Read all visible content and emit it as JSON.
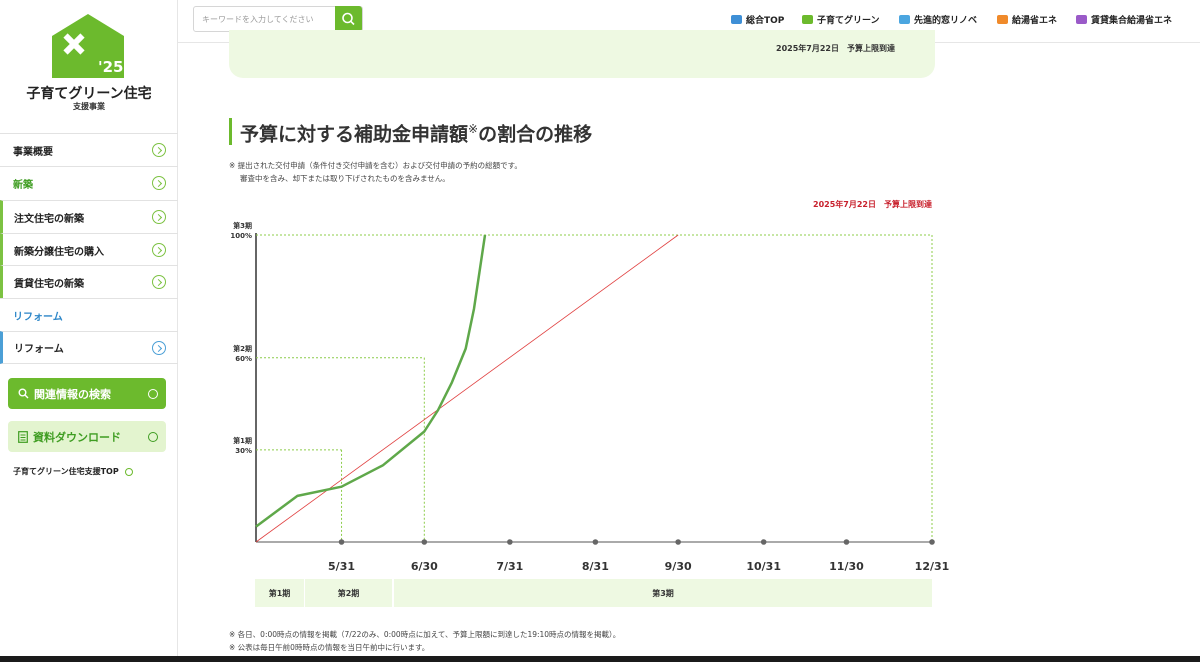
{
  "logo": {
    "year": "'25",
    "title": "子育てグリーン住宅",
    "subtitle": "支援事業"
  },
  "sidebar": {
    "items": [
      {
        "label": "事業概要"
      },
      {
        "label": "新築"
      },
      {
        "label": "注文住宅の新築"
      },
      {
        "label": "新築分譲住宅の購入"
      },
      {
        "label": "賃貸住宅の新築"
      },
      {
        "label": "リフォーム"
      },
      {
        "label": "リフォーム"
      }
    ],
    "search_button": "関連情報の検索",
    "download_button": "資料ダウンロード",
    "top_link": "子育てグリーン住宅支援TOP"
  },
  "topbar": {
    "search_placeholder": "キーワードを入力してください",
    "nav": [
      {
        "label": "総合TOP"
      },
      {
        "label": "子育てグリーン"
      },
      {
        "label": "先進的窓リノベ"
      },
      {
        "label": "給湯省エネ"
      },
      {
        "label": "賃貸集合給湯省エネ"
      }
    ]
  },
  "banner": {
    "date": "2025年7月22日",
    "status": "予算上限到達"
  },
  "section": {
    "title_prefix": "予算に対する補助金申請額",
    "title_mark": "※",
    "title_suffix": "の割合の推移",
    "note_line1": "※ 提出された交付申請（条件付き交付申請を含む）および交付申請の予約の総額です。",
    "note_line2": "審査中を含み、却下または取り下げされたものを含みません。",
    "reach_label": "2025年7月22日　予算上限到達"
  },
  "chart_data": {
    "type": "line",
    "x_ticks": [
      "5/31",
      "6/30",
      "7/31",
      "8/31",
      "9/30",
      "10/31",
      "11/30",
      "12/31"
    ],
    "y_ticks": [
      {
        "period": "第1期",
        "value": "30%"
      },
      {
        "period": "第2期",
        "value": "60%"
      },
      {
        "period": "第3期",
        "value": "100%"
      }
    ],
    "ylim": [
      0,
      100
    ],
    "reference_line": {
      "x": [
        "4/30",
        "9/30"
      ],
      "y": [
        0,
        100
      ],
      "color": "#e04040"
    },
    "series": [
      {
        "color": "#5fa84a",
        "x": [
          "4/30",
          "5/15",
          "5/31",
          "6/15",
          "6/30",
          "7/5",
          "7/10",
          "7/15",
          "7/18",
          "7/20",
          "7/22"
        ],
        "y": [
          5,
          15,
          18,
          25,
          36,
          43,
          52,
          63,
          76,
          88,
          100
        ]
      }
    ],
    "periods": [
      {
        "label": "第1期"
      },
      {
        "label": "第2期"
      },
      {
        "label": "第3期"
      }
    ]
  },
  "footnotes": [
    "※ 各日、0:00時点の情報を掲載（7/22のみ、0:00時点に加えて、予算上限額に到達した19:10時点の情報を掲載）。",
    "※ 公表は毎日午前0時時点の情報を当日午前中に行います。"
  ]
}
